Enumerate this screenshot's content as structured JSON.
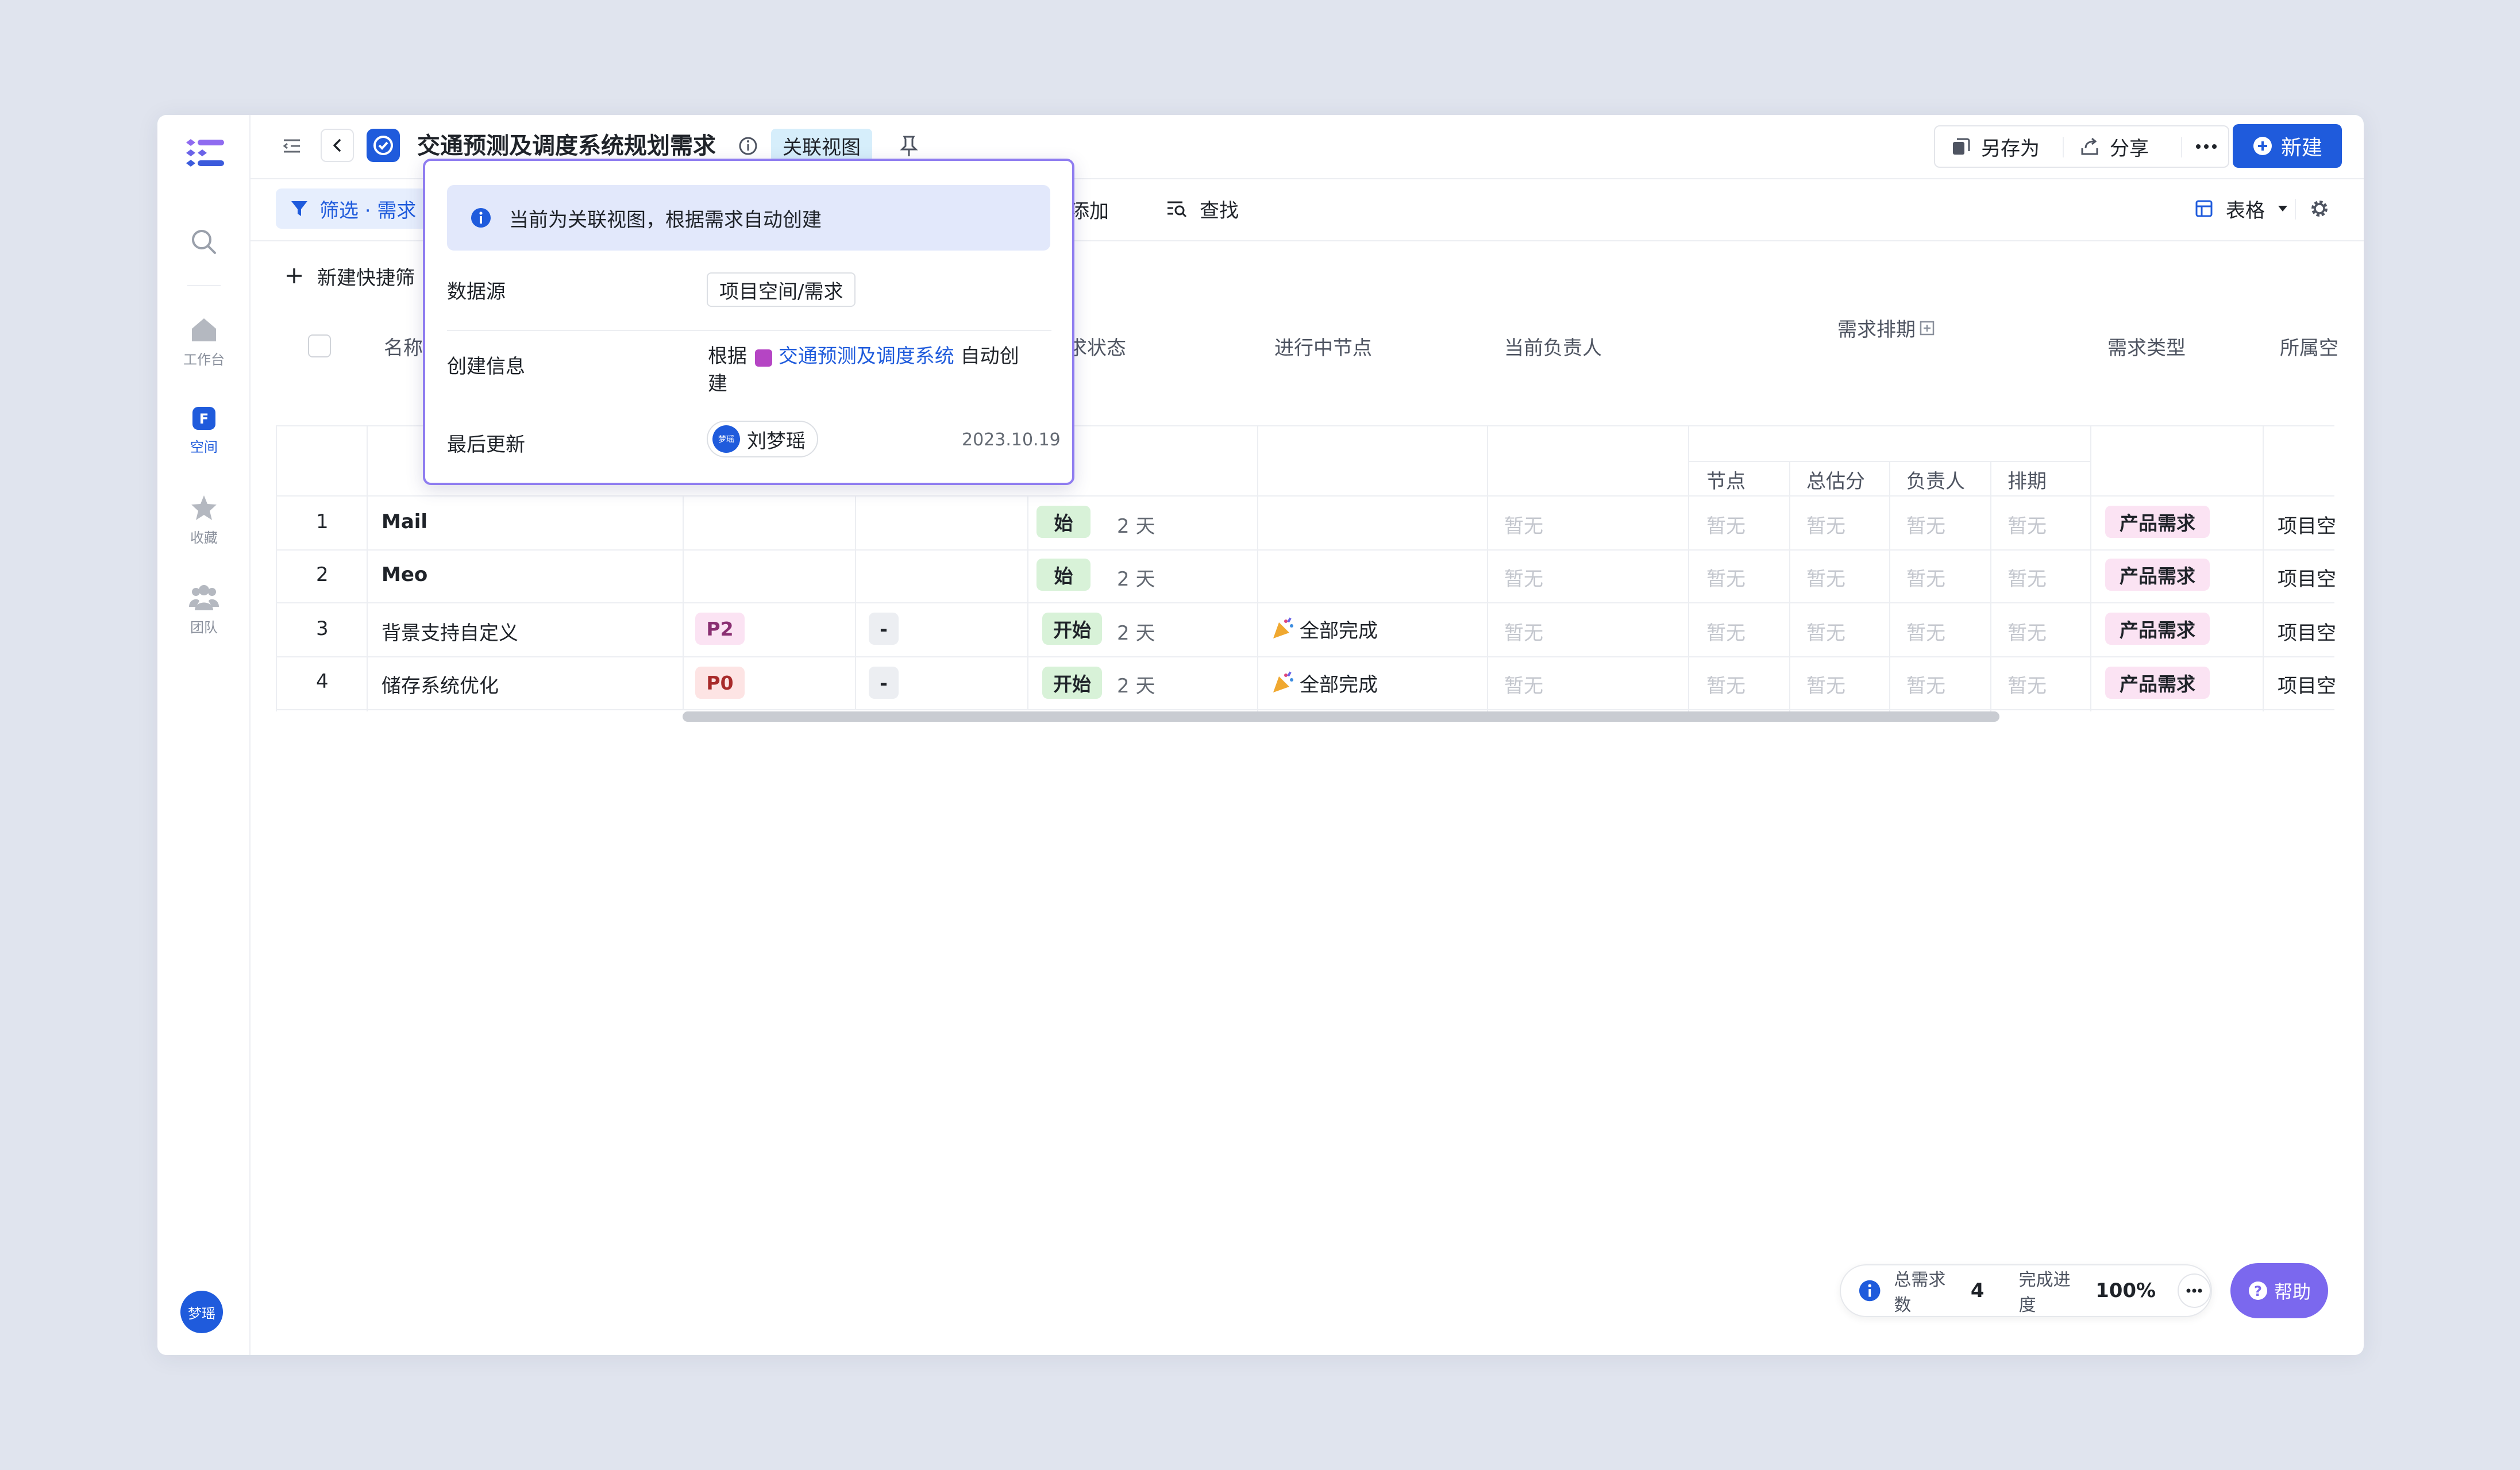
{
  "sidebar": {
    "nav": [
      {
        "label": "工作台",
        "icon": "home-icon"
      },
      {
        "label": "空间",
        "icon": "space-icon"
      },
      {
        "label": "收藏",
        "icon": "star-icon"
      },
      {
        "label": "团队",
        "icon": "team-icon"
      }
    ],
    "avatar": "梦瑶"
  },
  "header": {
    "title": "交通预测及调度系统规划需求",
    "view_badge": "关联视图",
    "save_as": "另存为",
    "share": "分享",
    "new": "新建"
  },
  "toolbar": {
    "filter": "筛选 · 需求",
    "add": "添加",
    "find": "查找",
    "view_mode": "表格",
    "new_quick_filter": "新建快捷筛"
  },
  "popover": {
    "notice": "当前为关联视图，根据需求自动创建",
    "source_label": "数据源",
    "source_value": "项目空间/需求",
    "created_label": "创建信息",
    "created_prefix": "根据",
    "created_link": "交通预测及调度系统",
    "created_suffix1": "自动创",
    "created_suffix2": "建",
    "updated_label": "最后更新",
    "updated_user": "刘梦瑶",
    "updated_user_avatar": "梦瑶",
    "updated_date": "2023.10.19"
  },
  "table": {
    "headers": {
      "name": "名称",
      "status": "求状态",
      "node": "进行中节点",
      "owner": "当前负责人",
      "schedule_group": "需求排期",
      "sub_node": "节点",
      "sub_points": "总估分",
      "sub_owner": "负责人",
      "sub_schedule": "排期",
      "type": "需求类型",
      "space": "所属空"
    },
    "rows": [
      {
        "num": "1",
        "name": "Mail",
        "priority": "",
        "dash": "",
        "status": "始",
        "days": "2 天",
        "node": "",
        "owner": "暂无",
        "s1": "暂无",
        "s2": "暂无",
        "s3": "暂无",
        "s4": "暂无",
        "type": "产品需求",
        "space": "项目空"
      },
      {
        "num": "2",
        "name": "Meo",
        "priority": "",
        "dash": "",
        "status": "始",
        "days": "2 天",
        "node": "",
        "owner": "暂无",
        "s1": "暂无",
        "s2": "暂无",
        "s3": "暂无",
        "s4": "暂无",
        "type": "产品需求",
        "space": "项目空"
      },
      {
        "num": "3",
        "name": "背景支持自定义",
        "priority": "P2",
        "dash": "-",
        "status": "开始",
        "days": "2 天",
        "node": "全部完成",
        "owner": "暂无",
        "s1": "暂无",
        "s2": "暂无",
        "s3": "暂无",
        "s4": "暂无",
        "type": "产品需求",
        "space": "项目空"
      },
      {
        "num": "4",
        "name": "储存系统优化",
        "priority": "P0",
        "dash": "-",
        "status": "开始",
        "days": "2 天",
        "node": "全部完成",
        "owner": "暂无",
        "s1": "暂无",
        "s2": "暂无",
        "s3": "暂无",
        "s4": "暂无",
        "type": "产品需求",
        "space": "项目空"
      }
    ]
  },
  "footer": {
    "total_label": "总需求数",
    "total_value": "4",
    "progress_label": "完成进度",
    "progress_value": "100%",
    "help": "帮助"
  },
  "colors": {
    "accent": "#1f5bdc",
    "purple": "#6b63e8",
    "status_green_bg": "#d8f2d8",
    "type_pink_bg": "#fbe3f3"
  }
}
